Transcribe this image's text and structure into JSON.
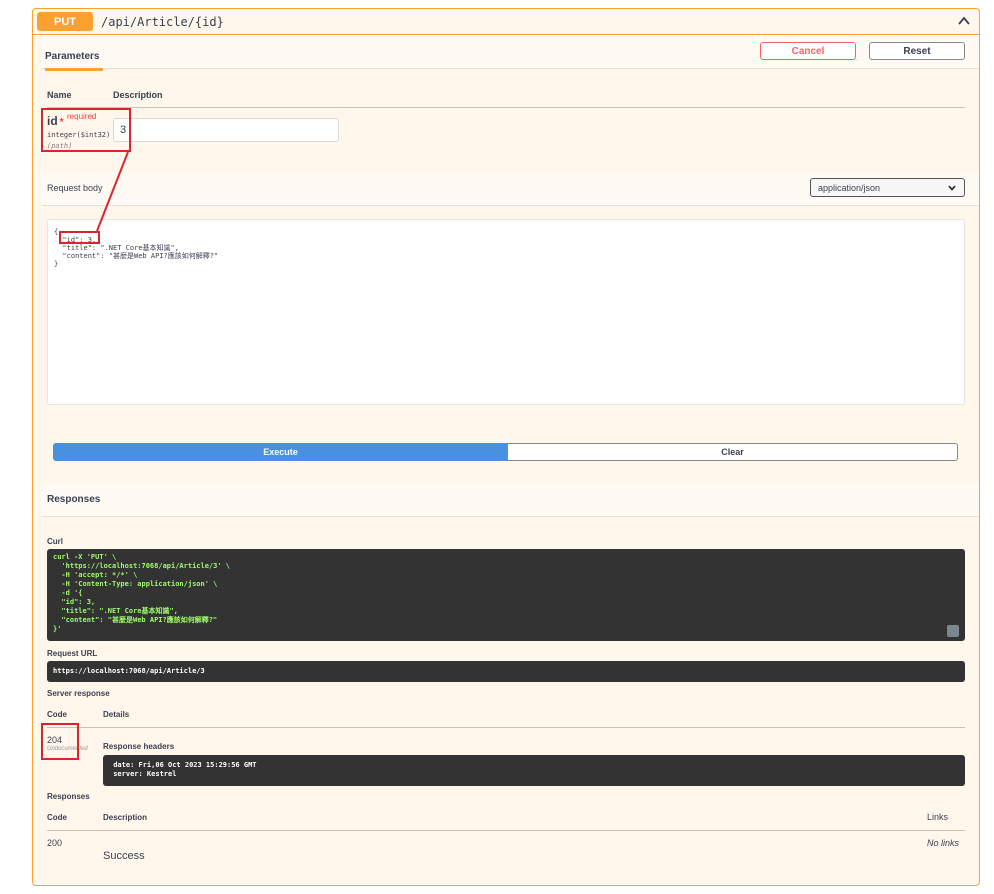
{
  "operation": {
    "method": "PUT",
    "path": "/api/Article/{id}",
    "color": "#fca130"
  },
  "parameters": {
    "tab_label": "Parameters",
    "cancel_label": "Cancel",
    "reset_label": "Reset",
    "columns": [
      "Name",
      "Description"
    ],
    "param": {
      "name": "id",
      "star": "*",
      "required": "required",
      "type": "integer($int32)",
      "in": "(path)",
      "value": "3"
    }
  },
  "request_body": {
    "label": "Request body",
    "content_type": "application/json",
    "body": "{\n  \"id\": 3,\n  \"title\": \".NET Core基本知識\",\n  \"content\": \"甚麼是Web API?應該如何解釋?\"\n}"
  },
  "actions": {
    "execute_label": "Execute",
    "clear_label": "Clear"
  },
  "responses_section": {
    "title": "Responses",
    "curl_label": "Curl",
    "curl": "curl -X 'PUT' \\\n  'https://localhost:7068/api/Article/3' \\\n  -H 'accept: */*' \\\n  -H 'Content-Type: application/json' \\\n  -d '{\n  \"id\": 3,\n  \"title\": \".NET Core基本知識\",\n  \"content\": \"甚麼是Web API?應該如何解釋?\"\n}'",
    "request_url_label": "Request URL",
    "request_url": "https://localhost:7068/api/Article/3",
    "server_response_label": "Server response",
    "code_header": "Code",
    "details_header": "Details",
    "code": "204",
    "undocumented": "Undocumented",
    "response_headers_label": "Response headers",
    "response_headers": " date: Fri,06 Oct 2023 15:29:56 GMT\n server: Kestrel"
  },
  "documented_responses": {
    "title": "Responses",
    "code_header": "Code",
    "description_header": "Description",
    "links_header": "Links",
    "rows": [
      {
        "code": "200",
        "description": "Success",
        "links": "No links"
      }
    ]
  }
}
